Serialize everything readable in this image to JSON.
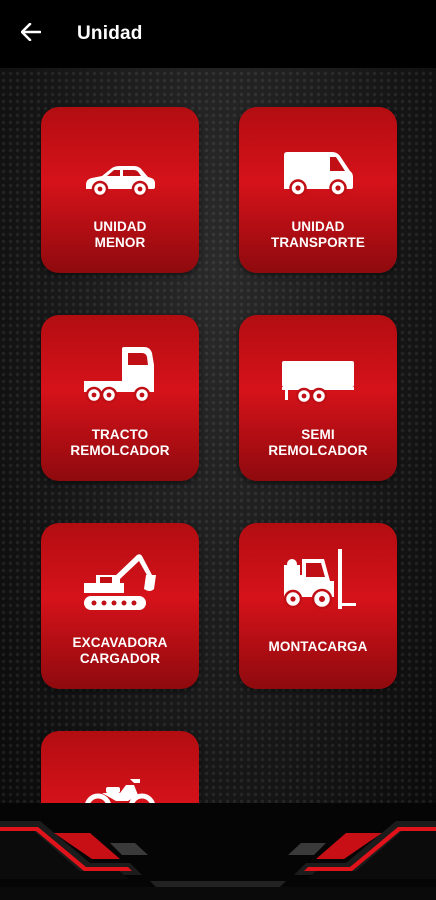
{
  "header": {
    "title": "Unidad",
    "back_icon": "arrow-left-icon"
  },
  "colors": {
    "card_red": "#d6121a",
    "header_bg": "#000000",
    "text": "#ffffff"
  },
  "units": [
    {
      "label": "UNIDAD\nMENOR",
      "icon": "car-icon"
    },
    {
      "label": "UNIDAD\nTRANSPORTE",
      "icon": "van-icon"
    },
    {
      "label": "TRACTO\nREMOLCADOR",
      "icon": "tractor-truck-icon"
    },
    {
      "label": "SEMI\nREMOLCADOR",
      "icon": "semi-trailer-icon"
    },
    {
      "label": "EXCAVADORA\nCARGADOR",
      "icon": "excavator-icon"
    },
    {
      "label": "MONTACARGA",
      "icon": "forklift-icon"
    },
    {
      "label": "",
      "icon": "motorcycle-icon"
    }
  ]
}
